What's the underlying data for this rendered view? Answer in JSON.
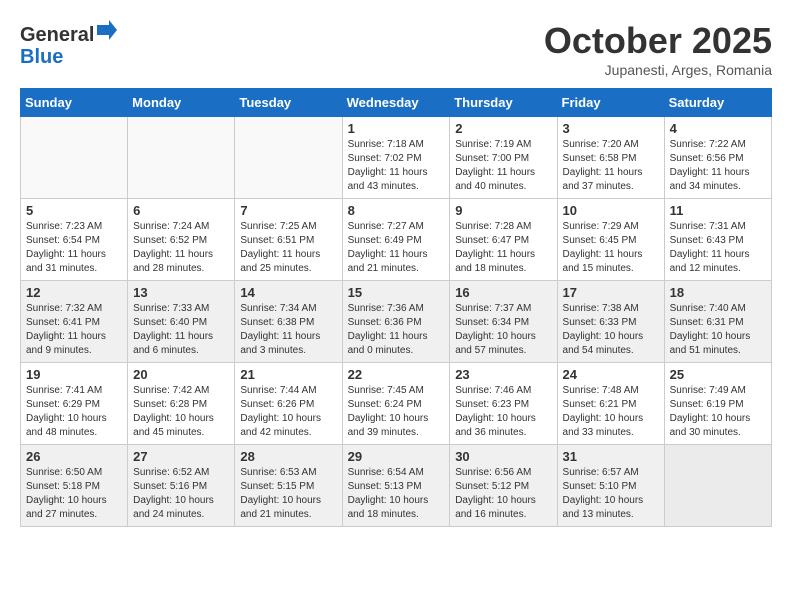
{
  "header": {
    "logo_general": "General",
    "logo_blue": "Blue",
    "month_title": "October 2025",
    "subtitle": "Jupanesti, Arges, Romania"
  },
  "days_of_week": [
    "Sunday",
    "Monday",
    "Tuesday",
    "Wednesday",
    "Thursday",
    "Friday",
    "Saturday"
  ],
  "weeks": [
    {
      "shade": false,
      "days": [
        {
          "num": "",
          "info": ""
        },
        {
          "num": "",
          "info": ""
        },
        {
          "num": "",
          "info": ""
        },
        {
          "num": "1",
          "info": "Sunrise: 7:18 AM\nSunset: 7:02 PM\nDaylight: 11 hours and 43 minutes."
        },
        {
          "num": "2",
          "info": "Sunrise: 7:19 AM\nSunset: 7:00 PM\nDaylight: 11 hours and 40 minutes."
        },
        {
          "num": "3",
          "info": "Sunrise: 7:20 AM\nSunset: 6:58 PM\nDaylight: 11 hours and 37 minutes."
        },
        {
          "num": "4",
          "info": "Sunrise: 7:22 AM\nSunset: 6:56 PM\nDaylight: 11 hours and 34 minutes."
        }
      ]
    },
    {
      "shade": false,
      "days": [
        {
          "num": "5",
          "info": "Sunrise: 7:23 AM\nSunset: 6:54 PM\nDaylight: 11 hours and 31 minutes."
        },
        {
          "num": "6",
          "info": "Sunrise: 7:24 AM\nSunset: 6:52 PM\nDaylight: 11 hours and 28 minutes."
        },
        {
          "num": "7",
          "info": "Sunrise: 7:25 AM\nSunset: 6:51 PM\nDaylight: 11 hours and 25 minutes."
        },
        {
          "num": "8",
          "info": "Sunrise: 7:27 AM\nSunset: 6:49 PM\nDaylight: 11 hours and 21 minutes."
        },
        {
          "num": "9",
          "info": "Sunrise: 7:28 AM\nSunset: 6:47 PM\nDaylight: 11 hours and 18 minutes."
        },
        {
          "num": "10",
          "info": "Sunrise: 7:29 AM\nSunset: 6:45 PM\nDaylight: 11 hours and 15 minutes."
        },
        {
          "num": "11",
          "info": "Sunrise: 7:31 AM\nSunset: 6:43 PM\nDaylight: 11 hours and 12 minutes."
        }
      ]
    },
    {
      "shade": true,
      "days": [
        {
          "num": "12",
          "info": "Sunrise: 7:32 AM\nSunset: 6:41 PM\nDaylight: 11 hours and 9 minutes."
        },
        {
          "num": "13",
          "info": "Sunrise: 7:33 AM\nSunset: 6:40 PM\nDaylight: 11 hours and 6 minutes."
        },
        {
          "num": "14",
          "info": "Sunrise: 7:34 AM\nSunset: 6:38 PM\nDaylight: 11 hours and 3 minutes."
        },
        {
          "num": "15",
          "info": "Sunrise: 7:36 AM\nSunset: 6:36 PM\nDaylight: 11 hours and 0 minutes."
        },
        {
          "num": "16",
          "info": "Sunrise: 7:37 AM\nSunset: 6:34 PM\nDaylight: 10 hours and 57 minutes."
        },
        {
          "num": "17",
          "info": "Sunrise: 7:38 AM\nSunset: 6:33 PM\nDaylight: 10 hours and 54 minutes."
        },
        {
          "num": "18",
          "info": "Sunrise: 7:40 AM\nSunset: 6:31 PM\nDaylight: 10 hours and 51 minutes."
        }
      ]
    },
    {
      "shade": false,
      "days": [
        {
          "num": "19",
          "info": "Sunrise: 7:41 AM\nSunset: 6:29 PM\nDaylight: 10 hours and 48 minutes."
        },
        {
          "num": "20",
          "info": "Sunrise: 7:42 AM\nSunset: 6:28 PM\nDaylight: 10 hours and 45 minutes."
        },
        {
          "num": "21",
          "info": "Sunrise: 7:44 AM\nSunset: 6:26 PM\nDaylight: 10 hours and 42 minutes."
        },
        {
          "num": "22",
          "info": "Sunrise: 7:45 AM\nSunset: 6:24 PM\nDaylight: 10 hours and 39 minutes."
        },
        {
          "num": "23",
          "info": "Sunrise: 7:46 AM\nSunset: 6:23 PM\nDaylight: 10 hours and 36 minutes."
        },
        {
          "num": "24",
          "info": "Sunrise: 7:48 AM\nSunset: 6:21 PM\nDaylight: 10 hours and 33 minutes."
        },
        {
          "num": "25",
          "info": "Sunrise: 7:49 AM\nSunset: 6:19 PM\nDaylight: 10 hours and 30 minutes."
        }
      ]
    },
    {
      "shade": true,
      "days": [
        {
          "num": "26",
          "info": "Sunrise: 6:50 AM\nSunset: 5:18 PM\nDaylight: 10 hours and 27 minutes."
        },
        {
          "num": "27",
          "info": "Sunrise: 6:52 AM\nSunset: 5:16 PM\nDaylight: 10 hours and 24 minutes."
        },
        {
          "num": "28",
          "info": "Sunrise: 6:53 AM\nSunset: 5:15 PM\nDaylight: 10 hours and 21 minutes."
        },
        {
          "num": "29",
          "info": "Sunrise: 6:54 AM\nSunset: 5:13 PM\nDaylight: 10 hours and 18 minutes."
        },
        {
          "num": "30",
          "info": "Sunrise: 6:56 AM\nSunset: 5:12 PM\nDaylight: 10 hours and 16 minutes."
        },
        {
          "num": "31",
          "info": "Sunrise: 6:57 AM\nSunset: 5:10 PM\nDaylight: 10 hours and 13 minutes."
        },
        {
          "num": "",
          "info": ""
        }
      ]
    }
  ]
}
